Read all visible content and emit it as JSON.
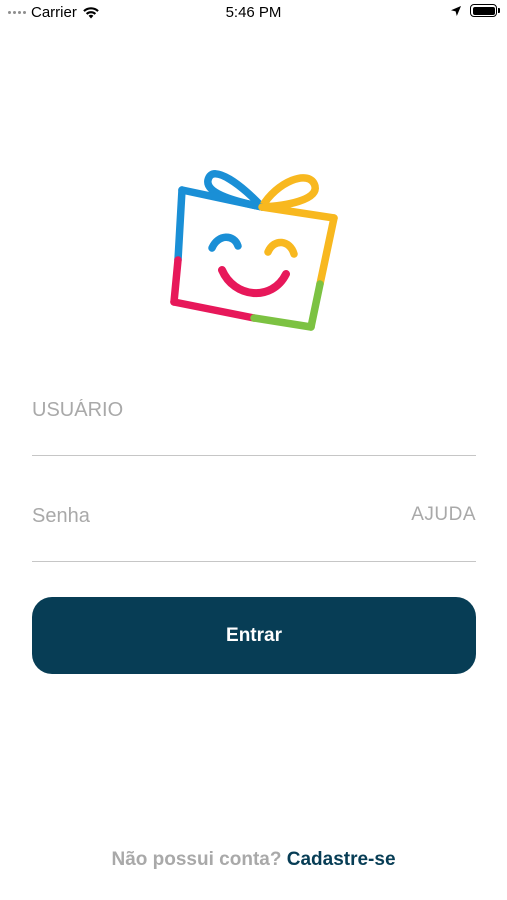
{
  "status_bar": {
    "carrier": "Carrier",
    "time": "5:46 PM"
  },
  "logo": {
    "icon": "smiling-gift-box",
    "colors": {
      "blue": "#1a8fd6",
      "yellow": "#f8b81f",
      "red": "#e7185a",
      "green": "#7cc242"
    }
  },
  "form": {
    "username_placeholder": "USUÁRIO",
    "password_placeholder": "Senha",
    "help_label": "AJUDA",
    "submit_label": "Entrar"
  },
  "footer": {
    "prompt": "Não possui conta?",
    "signup_label": "Cadastre-se"
  },
  "theme": {
    "primary": "#073d55",
    "muted": "#a9a9a9",
    "divider": "#c6c6c6"
  }
}
